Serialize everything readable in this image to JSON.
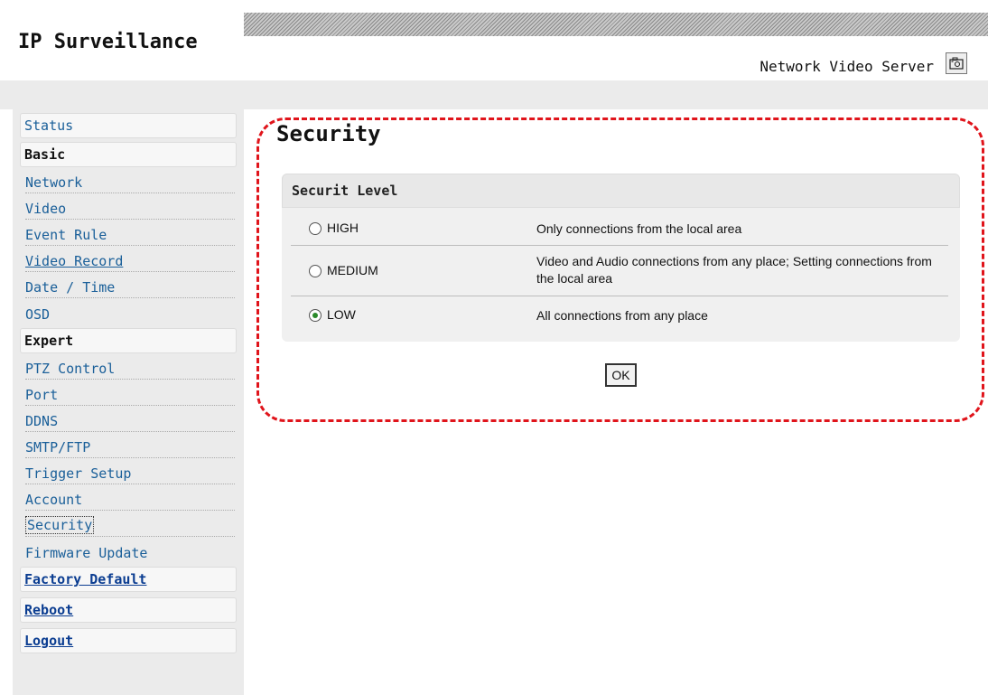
{
  "header": {
    "app_title": "IP Surveillance",
    "product_name": "Network Video Server",
    "camera_icon": "camera-icon"
  },
  "sidebar": {
    "status": "Status",
    "basic_heading": "Basic",
    "basic_items": [
      "Network",
      "Video",
      "Event Rule",
      "Video Record",
      "Date / Time",
      "OSD"
    ],
    "expert_heading": "Expert",
    "expert_items": [
      "PTZ Control",
      "Port",
      "DDNS",
      "SMTP/FTP",
      "Trigger Setup",
      "Account",
      "Security",
      "Firmware Update"
    ],
    "factory_default": "Factory Default",
    "reboot": "Reboot",
    "logout": "Logout",
    "active_item": "Security"
  },
  "main": {
    "title": "Security",
    "section_heading": "Securit Level",
    "options": [
      {
        "label": "HIGH",
        "desc": "Only connections from the local area",
        "selected": false
      },
      {
        "label": "MEDIUM",
        "desc": "Video and Audio connections from any place; Setting connections from the local area",
        "selected": false
      },
      {
        "label": "LOW",
        "desc": "All connections from any place",
        "selected": true
      }
    ],
    "ok_label": "OK"
  },
  "colors": {
    "link": "#1a5f99",
    "highlight_border": "#e0141b",
    "radio_dot": "#2a8a2a"
  }
}
